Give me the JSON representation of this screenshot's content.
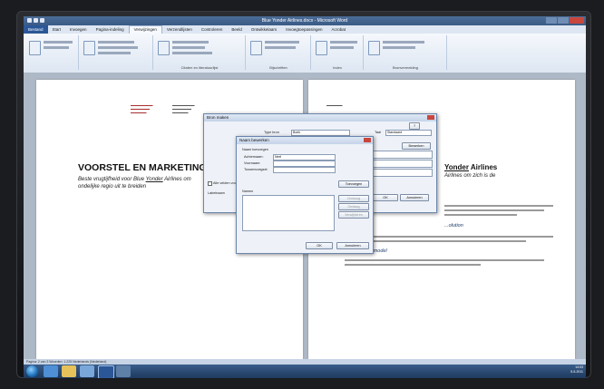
{
  "window": {
    "title": "Blue Yonder Airlines.docx - Microsoft Word"
  },
  "ribbon": {
    "tabs": [
      "Bestand",
      "Start",
      "Invoegen",
      "Pagina-indeling",
      "Verwijzingen",
      "Verzendlijsten",
      "Controleren",
      "Beeld",
      "Ontwikkelaars",
      "Invoegtoepassingen",
      "Acrobat"
    ],
    "groups": [
      "Bijschriften",
      "Citaten en literatuurlijst",
      "Index",
      "Bronvermelding"
    ]
  },
  "document": {
    "left_page": {
      "heading": "VOORSTEL EN MARKETING",
      "subtitle_pre": "Beste vrugtijfheid voor Blue ",
      "subtitle_link": "Yonder",
      "subtitle_post": " Airlines om",
      "subtitle_line2": "ondelijke regio uit te breiden"
    },
    "right_page": {
      "heading_link": "Yonder",
      "heading_post": " Airlines",
      "subtitle": "Airlines om zich is de",
      "section1": "...olution",
      "section2": "Vijf krachten model"
    }
  },
  "dialog_outer": {
    "title": "Bron maken",
    "type_label": "Type bron",
    "type_value": "Boek",
    "lang_label": "Taal",
    "lang_value": "Standaard",
    "edit_button": "Bewerken",
    "show_all_label": "Alle velden voor literatuurlijst weergeven",
    "tag_label": "Labelnaam",
    "ok_button": "OK",
    "cancel_button": "Annuleren",
    "help": "?"
  },
  "dialog_inner": {
    "title": "Naam bewerken",
    "add_label": "Naam toevoegen",
    "last_name_label": "Achternaam:",
    "last_name_value": "Neel",
    "first_name_label": "Voornaam:",
    "middle_name_label": "Tussenvoegsel:",
    "add_button": "Toevoegen",
    "names_label": "Namen",
    "up_button": "Omhoog",
    "down_button": "Omlaag",
    "delete_button": "Verwijderen",
    "ok_button": "OK",
    "cancel_button": "Annuleren"
  },
  "statusbar": {
    "text": "Pagina: 2 van 3   Woorden: 1.225   Nederlands (Nederland)"
  },
  "taskbar": {
    "time": "14:03",
    "date": "5-5-2011"
  },
  "colors": {
    "ribbon_file": "#2b5797",
    "titlebar": "#3a5a86",
    "taskbar": "#1e3a5f"
  }
}
